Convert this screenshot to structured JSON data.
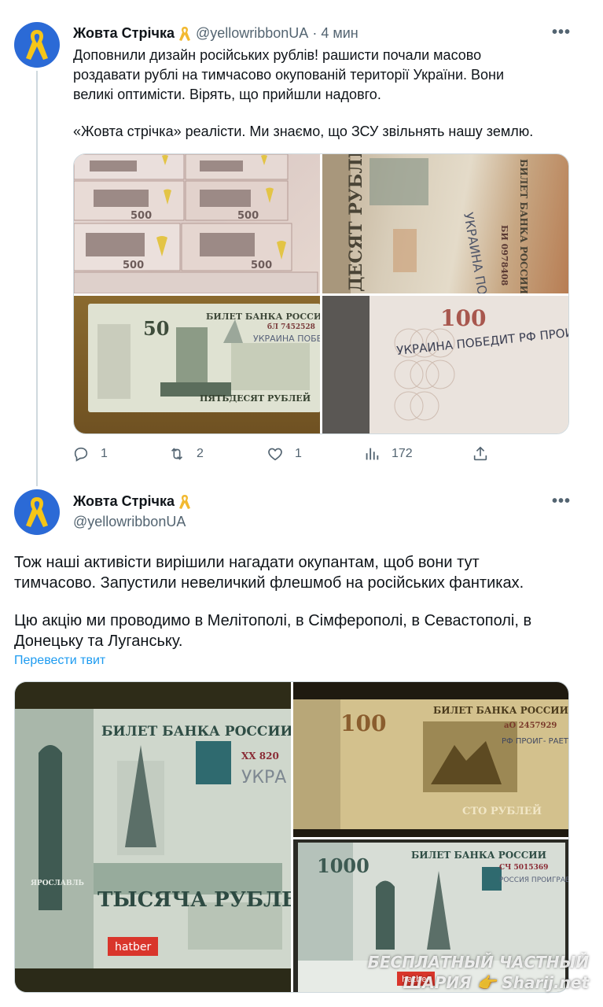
{
  "tweet1": {
    "author_name": "Жовта Стрічка",
    "handle": "@yellowribbonUA",
    "separator": "·",
    "time": "4 мин",
    "more": "•••",
    "text_lines": [
      "Доповнили дизайн російських рублів! рашисти почали масово",
      "роздавати рублі на тимчасово окупованій території України. Вони",
      "великі оптимісти. Вірять, що прийшли надовго."
    ],
    "text_line_last": "«Жовта стрічка» реалісти. Ми знаємо, що ЗСУ звільнять нашу землю.",
    "actions": {
      "replies": "1",
      "retweets": "2",
      "likes": "1",
      "views": "172"
    },
    "photos": {
      "p1_denomination": "500",
      "p2_header": "БИЛЕТ БАНКА РОССИИ",
      "p2_words": "ДЕСЯТ РУБЛЕЙ",
      "p2_serial": "БИ 0978408",
      "p2_handwriting": "УКРАИНА ПОБЕДИТ",
      "p3_header": "БИЛЕТ БАНКА РОССИИ",
      "p3_serial": "бЛ 7452528",
      "p3_denomination": "50",
      "p3_words": "ПЯТЬДЕСЯТ РУБЛЕЙ",
      "p3_handwriting": "УКРАИНА ПОБЕДИТ",
      "p4_denomination": "100",
      "p4_handwriting": "УКРАИНА ПОБЕДИТ РФ ПРОИГРА-"
    }
  },
  "tweet2": {
    "author_name": "Жовта Стрічка",
    "handle": "@yellowribbonUA",
    "more": "•••",
    "paragraph1": [
      "Тож наші активісти вирішили нагадати окупантам, щоб вони тут",
      "тимчасово. Запустили невеличкий флешмоб на російських фантиках."
    ],
    "paragraph2": [
      "Цю акцію ми проводимо в Мелітополі, в Сімферополі, в Севастополі, в",
      "Донецьку та Луганську."
    ],
    "translate": "Перевести твит",
    "photos": {
      "q1_header": "БИЛЕТ БАНКА РОССИИ",
      "q1_serial": "ХХ 820",
      "q1_words": "ТЫСЯЧА РУБЛЕЙ",
      "q1_city": "ЯРОСЛАВЛЬ",
      "q1_brand": "hatber",
      "q1_handwriting": "УКРА ПОБЕ",
      "q2_header": "БИЛЕТ БАНКА РОССИИ",
      "q2_serial": "аО 2457929",
      "q2_denomination": "100",
      "q2_words": "СТО РУБЛЕЙ",
      "q2_handwriting": "РФ ПРОИГ- РАЕТ ПУТИН- УБИЙЦА",
      "q3_header": "БИЛЕТ БАНКА РОССИИ",
      "q3_serial": "СЧ 5015369",
      "q3_denomination": "1000",
      "q3_brand": "hatber",
      "q3_handwriting": "РОССИЯ ПРОИГРАЕТ ПУТИН- УБИЙЦА"
    }
  },
  "watermark": {
    "line1": "БЕСПЛАТНЫЙ ЧАСТНЫЙ",
    "line2": "ШАРИЯ 👉 Sharij.net"
  },
  "colors": {
    "accent": "#1d9bf0",
    "secondary_text": "#536471",
    "avatar_bg": "#2b6ad6",
    "ribbon": "#f5c518"
  }
}
